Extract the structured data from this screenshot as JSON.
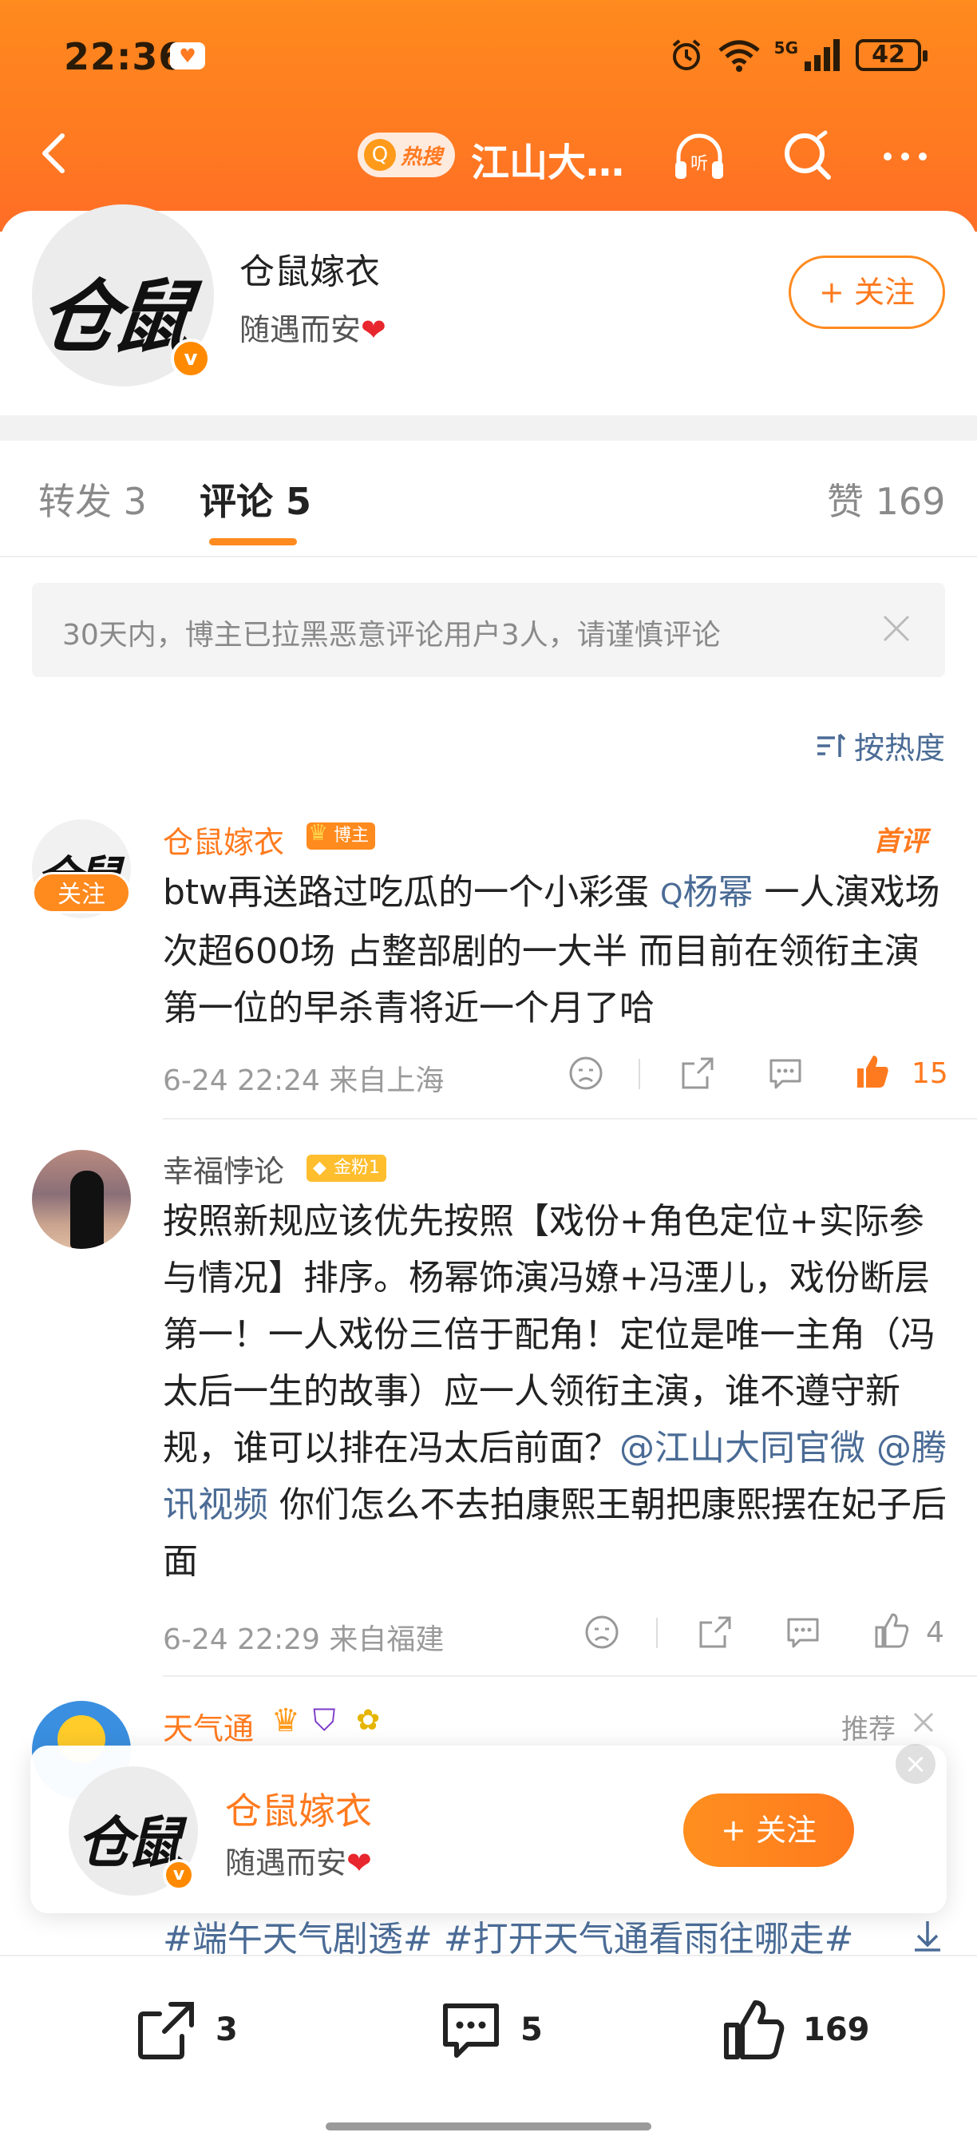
{
  "status": {
    "time": "22:36",
    "battery": "42",
    "network": "5G"
  },
  "nav": {
    "hot_label": "热搜",
    "title": "江山大…"
  },
  "profile": {
    "name": "仓鼠嫁衣",
    "bio": "随遇而安",
    "follow_label": "+ 关注",
    "avatar_text": "仓鼠"
  },
  "tabs": {
    "repost": "转发 3",
    "comments": "评论 5",
    "likes": "赞 169"
  },
  "notice": {
    "text": "30天内，博主已拉黑恶意评论用户3人，请谨慎评论"
  },
  "sort": {
    "label": "按热度"
  },
  "comments": [
    {
      "name": "仓鼠嫁衣",
      "badge": "博主",
      "tag": "首评",
      "follow_tag": "关注",
      "text_a": "btw再送路过吃瓜的一个小彩蛋 ",
      "link": "杨幂",
      "text_b": " 一人演戏场次超600场 占整部剧的一大半 而目前在领衔主演第一位的早杀青将近一个月了哈",
      "meta": "6-24 22:24 来自上海",
      "likes": "15"
    },
    {
      "name": "幸福悖论",
      "badge": "金粉1",
      "text_a": "按照新规应该优先按照【戏份+角色定位+实际参与情况】排序。杨幂饰演冯嫽+冯湮儿，戏份断层第一！一人戏份三倍于配角！定位是唯一主角（冯太后一生的故事）应一人领衔主演，谁不遵守新规，谁可以排在冯太后前面？",
      "link1": "@江山大同官微",
      "link2": "@腾讯视频",
      "text_b": " 你们怎么不去拍康熙王朝把康熙摆在妃子后面",
      "meta": "6-24 22:29 来自福建",
      "likes": "4"
    },
    {
      "name": "天气通",
      "tag": "推荐",
      "hashtags": "#端午天气剧透# #打开天气通看雨往哪走#"
    }
  ],
  "float_card": {
    "name": "仓鼠嫁衣",
    "bio": "随遇而安",
    "follow_label": "+ 关注"
  },
  "bottom": {
    "reposts": "3",
    "comments": "5",
    "likes": "169"
  }
}
